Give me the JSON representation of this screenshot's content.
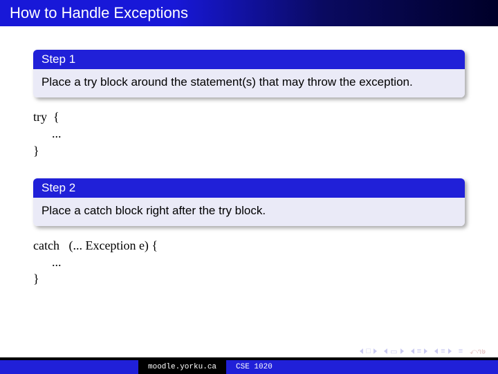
{
  "title": "How to Handle Exceptions",
  "blocks": [
    {
      "header": "Step 1",
      "body": "Place a try block around the statement(s) that may throw the exception.",
      "code": "try  {\n      ...\n}"
    },
    {
      "header": "Step 2",
      "body": "Place a catch block right after the try block.",
      "code": "catch   (... Exception e) {\n      ...\n}"
    }
  ],
  "footer": {
    "site": "moodle.yorku.ca",
    "course": "CSE 1020"
  },
  "nav_icons": {
    "first": "first-slide-icon",
    "prev": "prev-slide-icon",
    "up": "up-icon",
    "next": "next-slide-icon",
    "eq": "toc-icon",
    "undo": "undo-icon"
  }
}
